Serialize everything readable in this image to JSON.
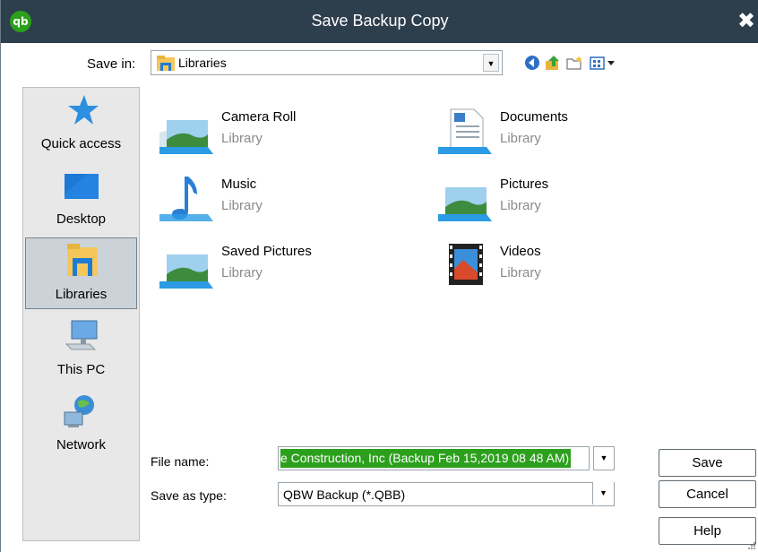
{
  "window": {
    "title": "Save Backup Copy",
    "app_logo": "qb"
  },
  "toolbar": {
    "save_in_label": "Save in:",
    "save_in_value": "Libraries",
    "icons": [
      "back-icon",
      "up-folder-icon",
      "new-folder-icon",
      "view-menu-icon"
    ]
  },
  "places": [
    {
      "label": "Quick access",
      "icon": "star-icon"
    },
    {
      "label": "Desktop",
      "icon": "desktop-icon"
    },
    {
      "label": "Libraries",
      "icon": "libraries-icon",
      "selected": true
    },
    {
      "label": "This PC",
      "icon": "computer-icon"
    },
    {
      "label": "Network",
      "icon": "network-icon"
    }
  ],
  "items": [
    {
      "name": "Camera Roll",
      "type": "Library",
      "icon": "picture-library-icon"
    },
    {
      "name": "Documents",
      "type": "Library",
      "icon": "documents-library-icon"
    },
    {
      "name": "Music",
      "type": "Library",
      "icon": "music-library-icon"
    },
    {
      "name": "Pictures",
      "type": "Library",
      "icon": "picture-library-icon"
    },
    {
      "name": "Saved Pictures",
      "type": "Library",
      "icon": "picture-library-icon"
    },
    {
      "name": "Videos",
      "type": "Library",
      "icon": "video-library-icon"
    }
  ],
  "form": {
    "file_name_label": "File name:",
    "file_name_value": "e Construction, Inc (Backup Feb 15,2019  08 48 AM)",
    "save_type_label": "Save as type:",
    "save_type_value": "QBW Backup (*.QBB)"
  },
  "buttons": {
    "save": "Save",
    "cancel": "Cancel",
    "help": "Help"
  },
  "colors": {
    "titlebar": "#2d3e4d",
    "selection": "#2ca01c",
    "places_bg": "#e8e8e8"
  }
}
